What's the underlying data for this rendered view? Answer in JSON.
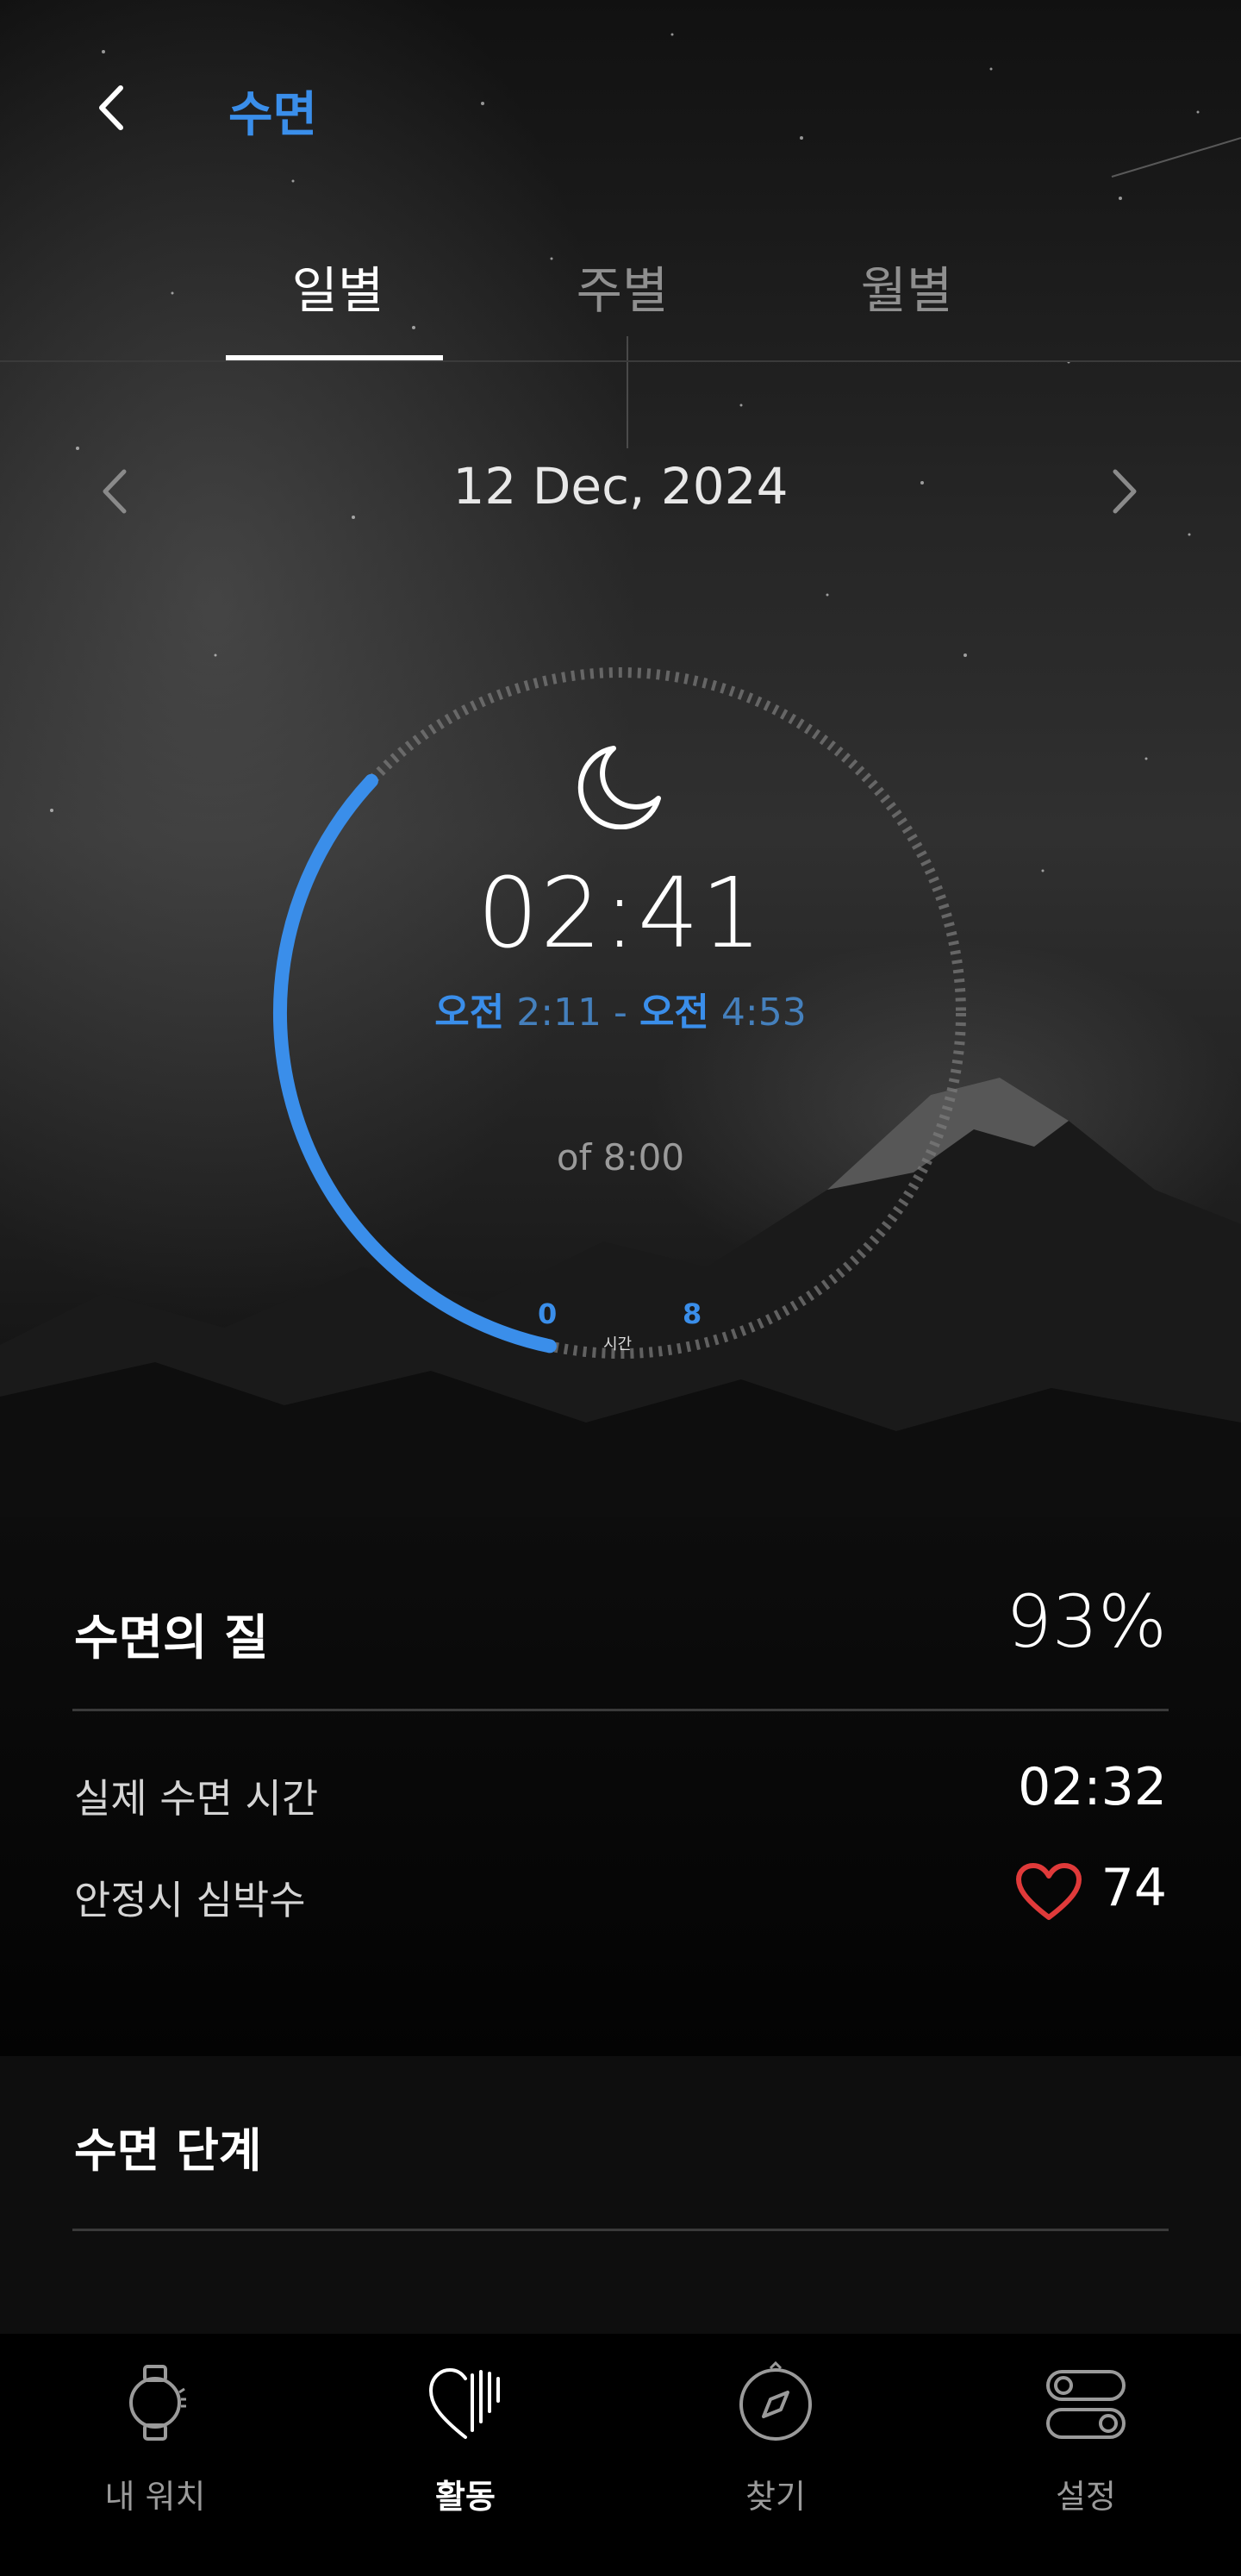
{
  "header": {
    "title": "수면",
    "back_icon": "chevron-left-icon"
  },
  "tabs": [
    {
      "label": "일별",
      "active": true
    },
    {
      "label": "주별",
      "active": false
    },
    {
      "label": "월별",
      "active": false
    }
  ],
  "date_nav": {
    "date": "12 Dec, 2024",
    "prev_icon": "chevron-left-icon",
    "next_icon": "chevron-right-icon"
  },
  "sleep_ring": {
    "icon": "moon-icon",
    "duration": "02:41",
    "start_ampm": "오전",
    "start_time": "2:11",
    "separator": "-",
    "end_ampm": "오전",
    "end_time": "4:53",
    "goal": "of 8:00",
    "axis_start": "0",
    "axis_end": "8",
    "axis_unit": "시간",
    "progress_fraction": 0.336,
    "accent_color": "#3a8eea"
  },
  "quality": {
    "label": "수면의 질",
    "value": "93%",
    "rows": [
      {
        "label": "실제 수면 시간",
        "value": "02:32"
      },
      {
        "label": "안정시 심박수",
        "value": "74",
        "icon": "heart-icon",
        "icon_color": "#e03a3a"
      }
    ]
  },
  "stages": {
    "label": "수면 단계"
  },
  "nav": [
    {
      "label": "내 워치",
      "icon": "watch-icon",
      "active": false
    },
    {
      "label": "활동",
      "icon": "activity-icon",
      "active": true
    },
    {
      "label": "찾기",
      "icon": "compass-icon",
      "active": false
    },
    {
      "label": "설정",
      "icon": "settings-toggle-icon",
      "active": false
    }
  ]
}
